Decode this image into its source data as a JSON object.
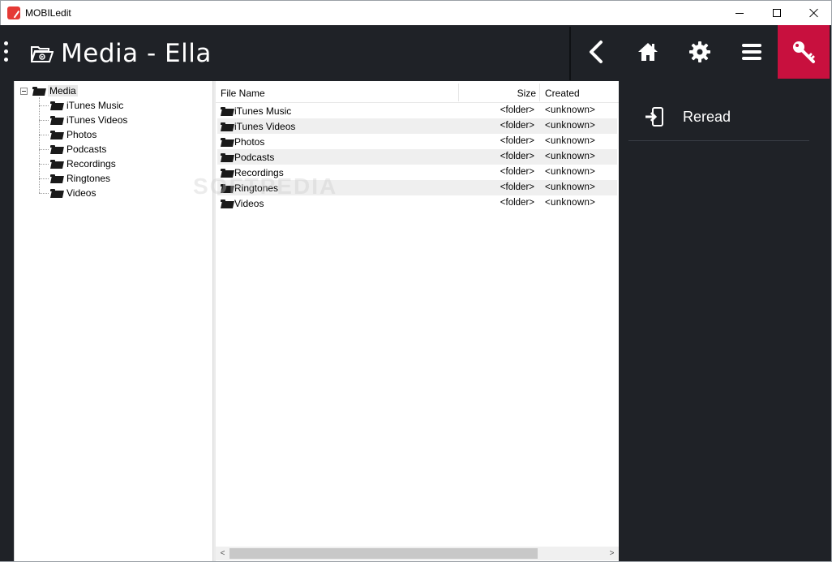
{
  "window": {
    "title": "MOBILedit"
  },
  "header": {
    "title": "Media - Ella"
  },
  "tree": {
    "root": "Media",
    "items": [
      "iTunes Music",
      "iTunes Videos",
      "Photos",
      "Podcasts",
      "Recordings",
      "Ringtones",
      "Videos"
    ]
  },
  "list": {
    "columns": {
      "name": "File Name",
      "size": "Size",
      "created": "Created"
    },
    "rows": [
      {
        "name": "iTunes Music",
        "size": "<folder>",
        "created": "<unknown>"
      },
      {
        "name": "iTunes Videos",
        "size": "<folder>",
        "created": "<unknown>"
      },
      {
        "name": "Photos",
        "size": "<folder>",
        "created": "<unknown>"
      },
      {
        "name": "Podcasts",
        "size": "<folder>",
        "created": "<unknown>"
      },
      {
        "name": "Recordings",
        "size": "<folder>",
        "created": "<unknown>"
      },
      {
        "name": "Ringtones",
        "size": "<folder>",
        "created": "<unknown>"
      },
      {
        "name": "Videos",
        "size": "<folder>",
        "created": "<unknown>"
      }
    ],
    "scroll_left": "<",
    "scroll_right": ">"
  },
  "actions": {
    "reread_label": "Reread"
  },
  "watermark": "SOFTPEDIA",
  "colors": {
    "header_bg": "#1f2227",
    "accent": "#c8103e"
  },
  "icons": {
    "back": "chevron-left-icon",
    "home": "home-icon",
    "settings": "gear-icon",
    "menu": "hamburger-icon",
    "key": "key-icon"
  }
}
